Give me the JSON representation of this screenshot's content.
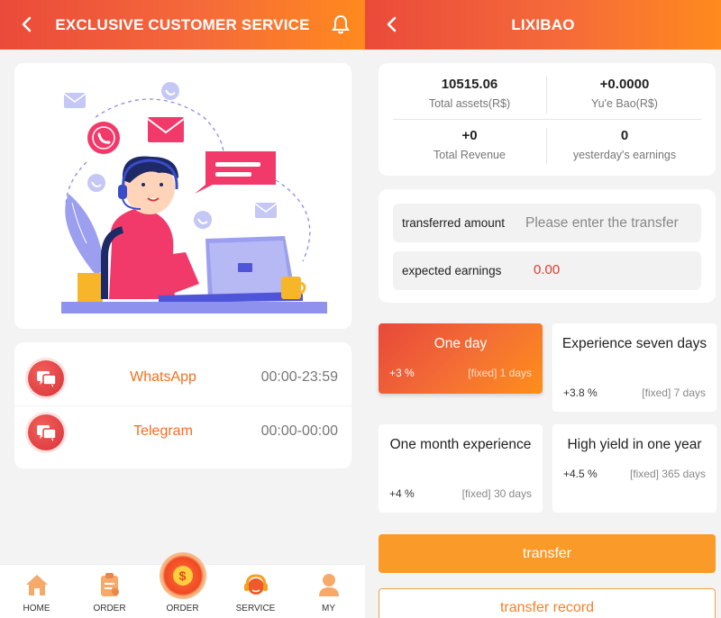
{
  "left": {
    "header": {
      "title": "EXCLUSIVE CUSTOMER SERVICE"
    },
    "contacts": [
      {
        "name": "WhatsApp",
        "hours": "00:00-23:59"
      },
      {
        "name": "Telegram",
        "hours": "00:00-00:00"
      }
    ],
    "tabbar": [
      {
        "label": "HOME",
        "icon": "home-icon"
      },
      {
        "label": "ORDER",
        "icon": "clipboard-icon"
      },
      {
        "label": "ORDER",
        "icon": "coin-icon"
      },
      {
        "label": "SERVICE",
        "icon": "headset-icon"
      },
      {
        "label": "MY",
        "icon": "user-icon"
      }
    ]
  },
  "right": {
    "header": {
      "title": "LIXIBAO"
    },
    "stats": {
      "total_assets": {
        "value": "10515.06",
        "label": "Total assets(R$)"
      },
      "yuebao": {
        "value": "+0.0000",
        "label": "Yu'e Bao(R$)"
      },
      "total_revenue": {
        "value": "+0",
        "label": "Total Revenue"
      },
      "yesterday": {
        "value": "0",
        "label": "yesterday's earnings"
      }
    },
    "transfer_field": {
      "label": "transferred amount",
      "placeholder": "Please enter the transfer"
    },
    "earnings_field": {
      "label": "expected earnings",
      "value": "0.00"
    },
    "plans": [
      {
        "name": "One day",
        "rate": "+3 %",
        "term": "[fixed] 1 days",
        "active": true
      },
      {
        "name": "Experience seven days",
        "rate": "+3.8 %",
        "term": "[fixed] 7 days",
        "active": false
      },
      {
        "name": "One month experience",
        "rate": "+4 %",
        "term": "[fixed] 30 days",
        "active": false
      },
      {
        "name": "High yield in one year",
        "rate": "+4.5 %",
        "term": "[fixed] 365 days",
        "active": false
      }
    ],
    "buttons": {
      "transfer": "transfer",
      "record": "transfer record"
    }
  },
  "colors": {
    "accent_start": "#ea4a3a",
    "accent_end": "#ff8a1e",
    "button": "#fa9a28",
    "contact_text": "#f36f20",
    "earning_value": "#e23b30"
  }
}
